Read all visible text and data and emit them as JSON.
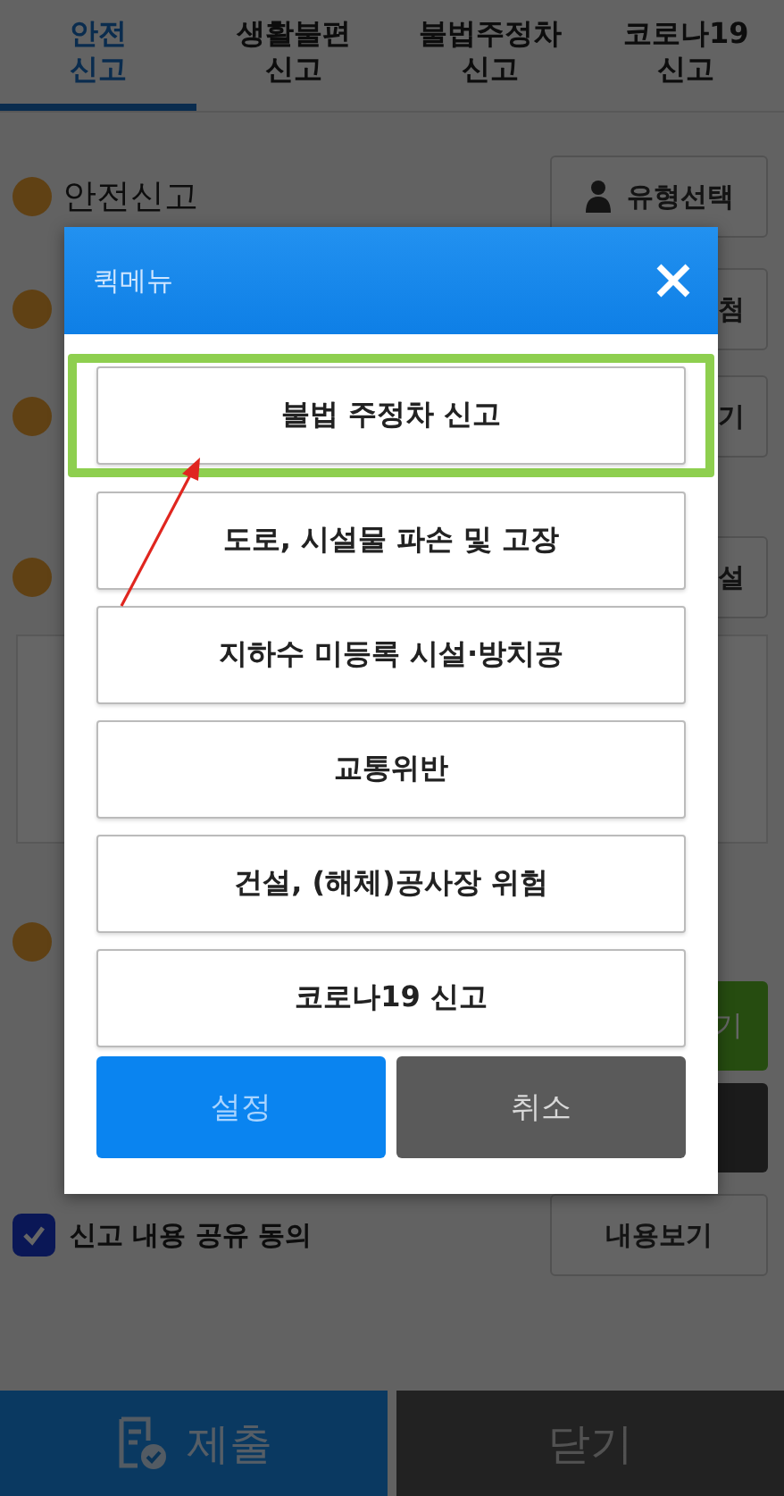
{
  "tabs": [
    {
      "label": "안전\n신고",
      "selected": true
    },
    {
      "label": "생활불편\n신고",
      "selected": false
    },
    {
      "label": "불법주정차\n신고",
      "selected": false
    },
    {
      "label": "코로나19\n신고",
      "selected": false
    }
  ],
  "section_title": "안전신고",
  "type_button": "유형선택",
  "side_buttons": [
    {
      "label": "첨",
      "kind": "light"
    },
    {
      "label": "기",
      "kind": "light"
    },
    {
      "label": "설",
      "kind": "light"
    }
  ],
  "action_buttons": [
    {
      "label": "기",
      "kind": "green"
    },
    {
      "kind": "dark"
    }
  ],
  "share_consent": {
    "label": "신고 내용 공유 동의",
    "checked": true
  },
  "view_button": "내용보기",
  "bottom_bar": {
    "submit": "제출",
    "close": "닫기"
  },
  "modal": {
    "title": "퀵메뉴",
    "items": [
      {
        "label": "불법 주정차 신고",
        "highlighted": true
      },
      {
        "label": "도로, 시설물 파손 및 고장",
        "highlighted": false
      },
      {
        "label": "지하수 미등록 시설·방치공",
        "highlighted": false
      },
      {
        "label": "교통위반",
        "highlighted": false
      },
      {
        "label": "건설, (해체)공사장 위험",
        "highlighted": false
      },
      {
        "label": "코로나19 신고",
        "highlighted": false
      }
    ],
    "confirm": "설정",
    "cancel": "취소"
  }
}
